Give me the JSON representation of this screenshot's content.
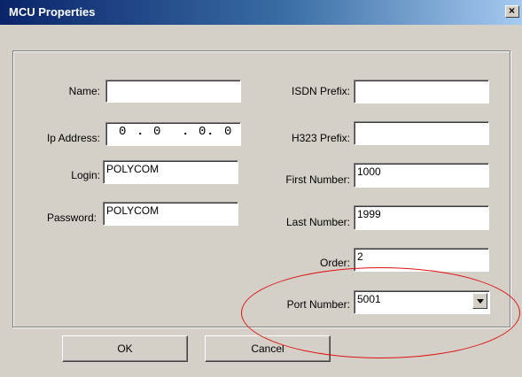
{
  "window": {
    "title": "MCU Properties",
    "close_label": "×"
  },
  "left": {
    "name": {
      "label": "Name:",
      "value": ""
    },
    "ip": {
      "label": "Ip Address:",
      "octets": [
        "0",
        "0",
        "0",
        "0"
      ]
    },
    "login": {
      "label": "Login:",
      "value": "POLYCOM"
    },
    "password": {
      "label": "Password:",
      "value": "POLYCOM"
    }
  },
  "right": {
    "isdn": {
      "label": "ISDN Prefix:",
      "value": ""
    },
    "h323": {
      "label": "H323 Prefix:",
      "value": ""
    },
    "first": {
      "label": "First Number:",
      "value": "1000"
    },
    "last": {
      "label": "Last Number:",
      "value": "1999"
    },
    "order": {
      "label": "Order:",
      "value": "2"
    },
    "port": {
      "label": "Port Number:",
      "value": "5001"
    }
  },
  "buttons": {
    "ok": "OK",
    "cancel": "Cancel"
  },
  "annotation": {
    "color": "#e01010",
    "shape": "ellipse"
  }
}
